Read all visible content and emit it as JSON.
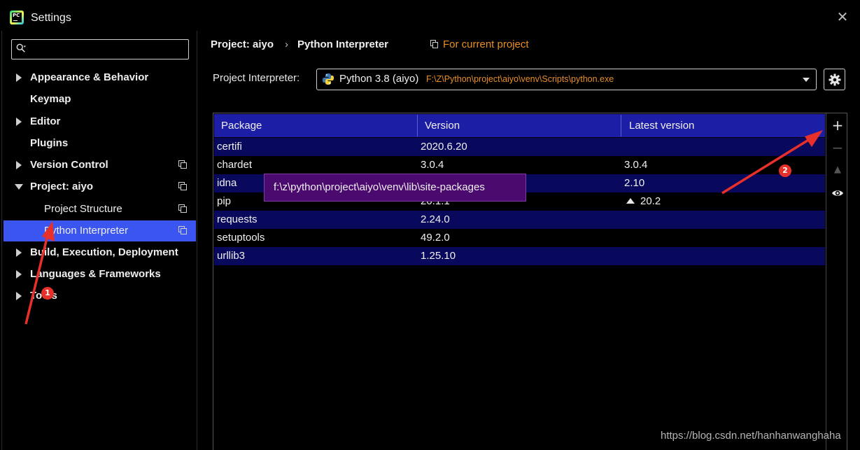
{
  "window": {
    "title": "Settings",
    "app_icon_text": "PC"
  },
  "search": {
    "placeholder": "",
    "value": ""
  },
  "sidebar": {
    "items": [
      {
        "label": "Appearance & Behavior",
        "expandable": true,
        "expanded": false
      },
      {
        "label": "Keymap",
        "expandable": false
      },
      {
        "label": "Editor",
        "expandable": true,
        "expanded": false
      },
      {
        "label": "Plugins",
        "expandable": false
      },
      {
        "label": "Version Control",
        "expandable": true,
        "expanded": false,
        "project_scoped": true
      },
      {
        "label": "Project: aiyo",
        "expandable": true,
        "expanded": true,
        "project_scoped": true
      },
      {
        "label": "Project Structure",
        "sub": true,
        "project_scoped": true
      },
      {
        "label": "Python Interpreter",
        "sub": true,
        "selected": true,
        "project_scoped": true
      },
      {
        "label": "Build, Execution, Deployment",
        "expandable": true,
        "expanded": false
      },
      {
        "label": "Languages & Frameworks",
        "expandable": true,
        "expanded": false
      },
      {
        "label": "Tools",
        "expandable": true,
        "expanded": false
      }
    ]
  },
  "breadcrumb": {
    "project": "Project: aiyo",
    "separator": "›",
    "page": "Python Interpreter",
    "scope": "For current project"
  },
  "interpreter": {
    "label": "Project Interpreter:",
    "name": "Python 3.8 (aiyo)",
    "path": "F:\\Z\\Python\\project\\aiyo\\venv\\Scripts\\python.exe"
  },
  "table": {
    "columns": [
      "Package",
      "Version",
      "Latest version"
    ],
    "rows": [
      {
        "package": "certifi",
        "version": "2020.6.20",
        "latest": ""
      },
      {
        "package": "chardet",
        "version": "3.0.4",
        "latest": "3.0.4"
      },
      {
        "package": "idna",
        "version": "",
        "latest": "2.10"
      },
      {
        "package": "pip",
        "version": "20.1.1",
        "latest": "20.2",
        "upgrade": true
      },
      {
        "package": "requests",
        "version": "2.24.0",
        "latest": ""
      },
      {
        "package": "setuptools",
        "version": "49.2.0",
        "latest": ""
      },
      {
        "package": "urllib3",
        "version": "1.25.10",
        "latest": ""
      }
    ]
  },
  "tools": {
    "add": "+",
    "remove": "−",
    "upgrade": "▲",
    "show": "eye"
  },
  "tooltip": {
    "text": "f:\\z\\python\\project\\aiyo\\venv\\lib\\site-packages"
  },
  "annotations": {
    "badge1": "1",
    "badge2": "2",
    "color": "#e8302a"
  },
  "watermark": "https://blog.csdn.net/hanhanwanghaha",
  "colors": {
    "selected": "#3b55f0",
    "header": "#1c1fa6",
    "alt_row": "#08085c",
    "orange": "#e88e24",
    "tooltip": "#4a0a6e"
  }
}
